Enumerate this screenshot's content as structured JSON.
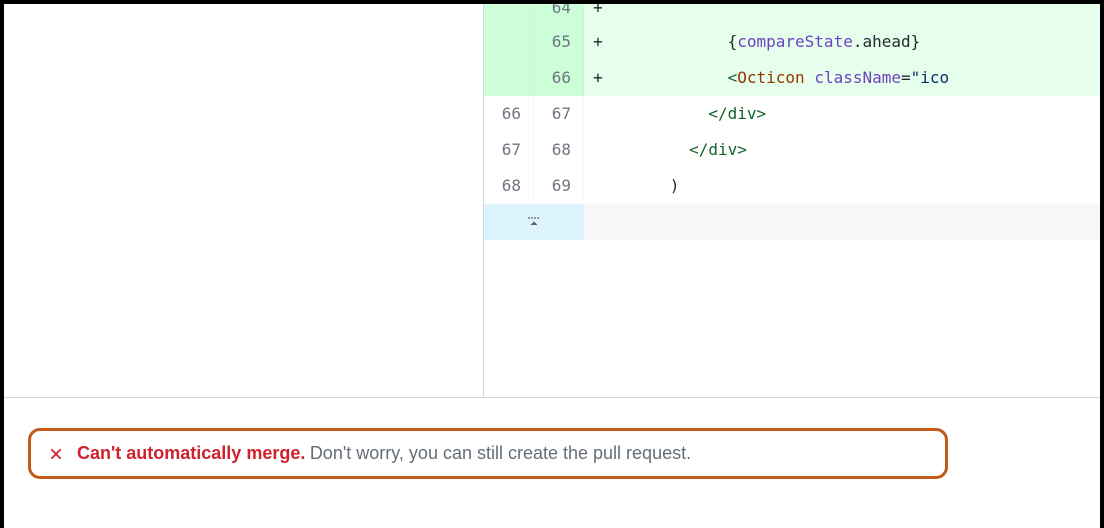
{
  "diff": {
    "rows": [
      {
        "type": "addition",
        "old": "",
        "new": "64",
        "marker": "+",
        "first": true,
        "tokens": []
      },
      {
        "type": "addition",
        "old": "",
        "new": "65",
        "marker": "+",
        "tokens": [
          {
            "t": "plain",
            "v": "            "
          },
          {
            "t": "brace",
            "v": "{"
          },
          {
            "t": "var",
            "v": "compareState"
          },
          {
            "t": "plain",
            "v": "."
          },
          {
            "t": "prop",
            "v": "ahead"
          },
          {
            "t": "brace",
            "v": "}"
          }
        ]
      },
      {
        "type": "addition",
        "old": "",
        "new": "66",
        "marker": "+",
        "tokens": [
          {
            "t": "plain",
            "v": "            "
          },
          {
            "t": "punct",
            "v": "<"
          },
          {
            "t": "comp",
            "v": "Octicon"
          },
          {
            "t": "plain",
            "v": " "
          },
          {
            "t": "attr",
            "v": "className"
          },
          {
            "t": "eq",
            "v": "="
          },
          {
            "t": "str",
            "v": "\"ico"
          }
        ]
      },
      {
        "type": "context",
        "old": "66",
        "new": "67",
        "marker": " ",
        "tokens": [
          {
            "t": "plain",
            "v": "          "
          },
          {
            "t": "punct",
            "v": "</"
          },
          {
            "t": "tag",
            "v": "div"
          },
          {
            "t": "punct",
            "v": ">"
          }
        ]
      },
      {
        "type": "context",
        "old": "67",
        "new": "68",
        "marker": " ",
        "tokens": [
          {
            "t": "plain",
            "v": "        "
          },
          {
            "t": "punct",
            "v": "</"
          },
          {
            "t": "tag",
            "v": "div"
          },
          {
            "t": "punct",
            "v": ">"
          }
        ]
      },
      {
        "type": "context",
        "old": "68",
        "new": "69",
        "marker": " ",
        "tokens": [
          {
            "t": "plain",
            "v": "      )"
          }
        ]
      }
    ]
  },
  "merge": {
    "title": "Can't automatically merge.",
    "subtitle": "Don't worry, you can still create the pull request."
  }
}
